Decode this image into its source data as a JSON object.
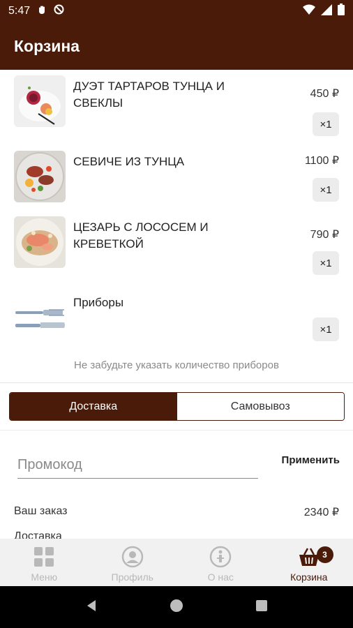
{
  "status_bar": {
    "time": "5:47"
  },
  "app_bar": {
    "title": "Корзина"
  },
  "colors": {
    "brand": "#4a1b08",
    "inactive_nav": "#b8b8b8"
  },
  "cart": {
    "items": [
      {
        "name": "ДУЭТ ТАРТАРОВ ТУНЦА И СВЕКЛЫ",
        "price": "450 ₽",
        "quantity": "×1",
        "image": "tuna-beet-tartare-photo"
      },
      {
        "name": "СЕВИЧЕ ИЗ ТУНЦА",
        "price": "1100 ₽",
        "quantity": "×1",
        "image": "tuna-ceviche-photo"
      },
      {
        "name": "ЦЕЗАРЬ С ЛОСОСЕМ И КРЕВЕТКОЙ",
        "price": "790 ₽",
        "quantity": "×1",
        "image": "caesar-salmon-shrimp-photo"
      },
      {
        "name": "Приборы",
        "price": "",
        "quantity": "×1",
        "image": "cutlery-photo"
      }
    ],
    "hint": "Не забудьте указать количество приборов"
  },
  "delivery_toggle": {
    "delivery": "Доставка",
    "pickup": "Самовывоз",
    "selected": "Доставка"
  },
  "promo": {
    "placeholder": "Промокод",
    "apply": "Применить"
  },
  "summary": {
    "order_label": "Ваш заказ",
    "order_value": "2340 ₽",
    "delivery_label": "Доставка"
  },
  "bottom_nav": {
    "items": [
      {
        "label": "Меню",
        "icon": "grid-icon"
      },
      {
        "label": "Профиль",
        "icon": "profile-icon"
      },
      {
        "label": "О нас",
        "icon": "info-icon"
      },
      {
        "label": "Корзина",
        "icon": "basket-icon"
      }
    ],
    "cart_badge": "3",
    "active": "Корзина"
  }
}
